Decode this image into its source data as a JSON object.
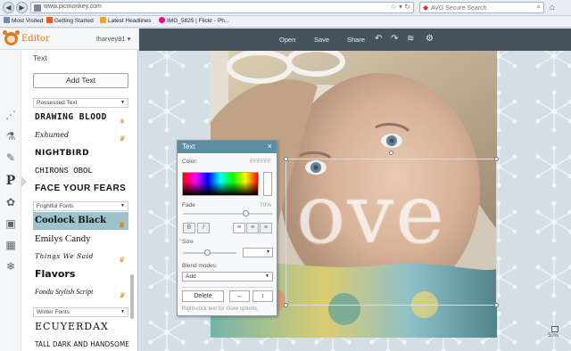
{
  "browser": {
    "url": "www.picmonkey.com",
    "search_placeholder": "AVG Secure Search",
    "bookmarks": [
      "Most Visited",
      "Getting Started",
      "Latest Headlines",
      "IMG_5825 | Flickr - Ph..."
    ]
  },
  "app": {
    "title": "Editor",
    "user": "lharvey81 ▾",
    "toolbar": {
      "open": "Open",
      "save": "Save",
      "share": "Share"
    },
    "zoom_label": "50%"
  },
  "text_panel": {
    "title": "Text",
    "add_text_label": "Add Text",
    "categories": [
      {
        "name": "Possessed Text",
        "fonts": [
          {
            "name": "DRAWING BLOOD",
            "premium": true
          },
          {
            "name": "Exhumed",
            "premium": true
          },
          {
            "name": "NIGHTBIRD",
            "premium": false
          },
          {
            "name": "CHIRONS OBOL",
            "premium": false
          },
          {
            "name": "FACE YOUR FEARS",
            "premium": false
          }
        ]
      },
      {
        "name": "Frightful Fonts",
        "fonts": [
          {
            "name": "Coolock Black",
            "premium": true,
            "selected": true
          },
          {
            "name": "Emilys Candy",
            "premium": false
          },
          {
            "name": "Things We Said",
            "premium": true
          },
          {
            "name": "Flavors",
            "premium": false
          },
          {
            "name": "Fondu Stylish Script",
            "premium": true
          }
        ]
      },
      {
        "name": "Winter Fonts",
        "fonts": [
          {
            "name": "ECUYERDAX",
            "premium": false
          },
          {
            "name": "TALL DARK AND HANDSOME",
            "premium": false
          }
        ]
      }
    ]
  },
  "dialog": {
    "title": "Text",
    "close": "×",
    "color_label": "Color:",
    "color_value": "FFFFFF",
    "fade_label": "Fade",
    "fade_value": "70%",
    "fade": 0.7,
    "bold": "B",
    "italic": "I",
    "size_label": "Size",
    "size": 0.35,
    "blend_label": "Blend modes:",
    "blend_value": "Add",
    "delete_label": "Delete",
    "flip_h": "↔",
    "flip_v": "↕",
    "hint": "Right-click text for more options."
  },
  "canvas": {
    "text": "ove"
  }
}
